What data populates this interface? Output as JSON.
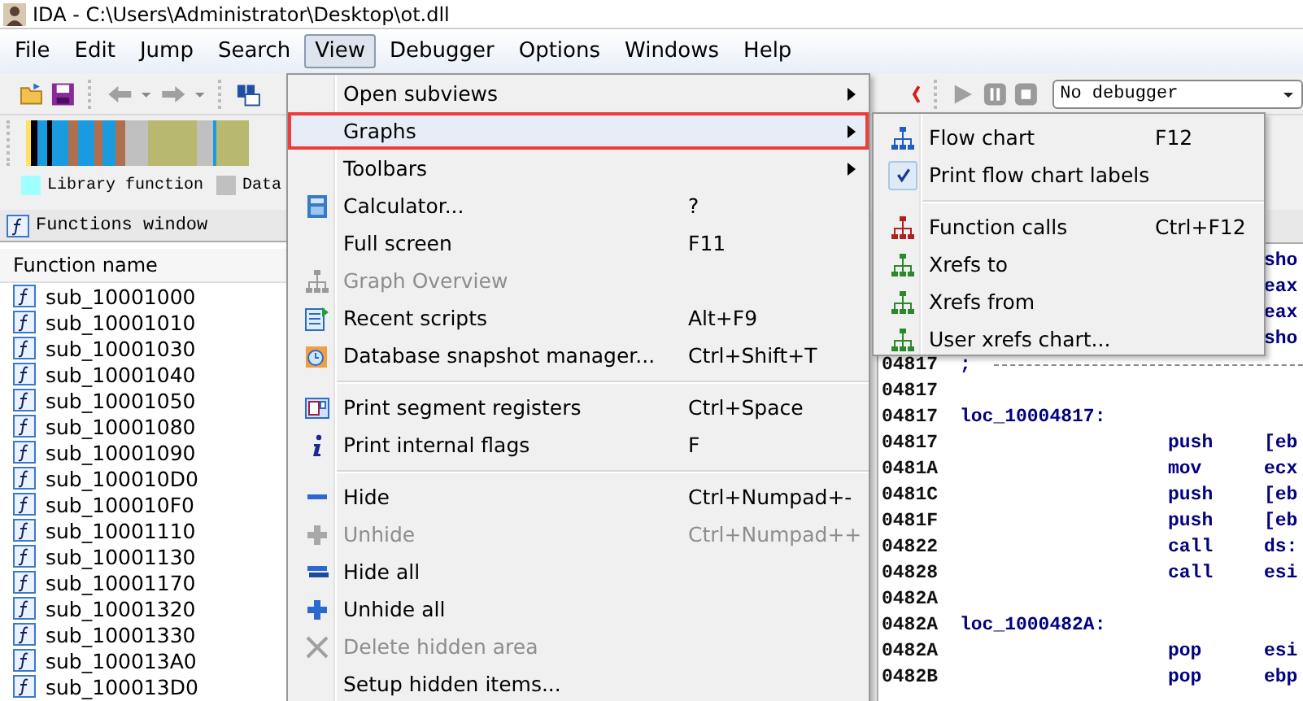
{
  "window": {
    "title": "IDA - C:\\Users\\Administrator\\Desktop\\ot.dll"
  },
  "menu_bar": [
    {
      "label": "File",
      "selected": false
    },
    {
      "label": "Edit",
      "selected": false
    },
    {
      "label": "Jump",
      "selected": false
    },
    {
      "label": "Search",
      "selected": false
    },
    {
      "label": "View",
      "selected": true
    },
    {
      "label": "Debugger",
      "selected": false
    },
    {
      "label": "Options",
      "selected": false
    },
    {
      "label": "Windows",
      "selected": false
    },
    {
      "label": "Help",
      "selected": false
    }
  ],
  "debugger_select": {
    "value": "No debugger"
  },
  "legend": [
    {
      "label": "Library function",
      "color": "#a0ffff"
    },
    {
      "label": "Data",
      "color": "#c0c0c0"
    }
  ],
  "functions_window": {
    "title": "Functions window",
    "column": "Function name",
    "rows": [
      "sub_10001000",
      "sub_10001010",
      "sub_10001030",
      "sub_10001040",
      "sub_10001050",
      "sub_10001080",
      "sub_10001090",
      "sub_100010D0",
      "sub_100010F0",
      "sub_10001110",
      "sub_10001130",
      "sub_10001170",
      "sub_10001320",
      "sub_10001330",
      "sub_100013A0",
      "sub_100013D0"
    ]
  },
  "disassembly": {
    "lines": [
      {
        "kind": "code",
        "operand": "sho"
      },
      {
        "kind": "code",
        "operand": "eax"
      },
      {
        "kind": "code",
        "operand": "eax"
      },
      {
        "kind": "code",
        "operand": "sho"
      },
      {
        "kind": "comment",
        "address": "04817",
        "text": ";"
      },
      {
        "kind": "code",
        "address": "04817"
      },
      {
        "kind": "code",
        "address": "04817",
        "label": "loc_10004817:"
      },
      {
        "kind": "code",
        "address": "04817",
        "mnemonic": "push",
        "operand": "[eb"
      },
      {
        "kind": "code",
        "address": "0481A",
        "mnemonic": "mov",
        "operand": "ecx"
      },
      {
        "kind": "code",
        "address": "0481C",
        "mnemonic": "push",
        "operand": "[eb"
      },
      {
        "kind": "code",
        "address": "0481F",
        "mnemonic": "push",
        "operand": "[eb"
      },
      {
        "kind": "code",
        "address": "04822",
        "mnemonic": "call",
        "operand": "ds:"
      },
      {
        "kind": "code",
        "address": "04828",
        "mnemonic": "call",
        "operand": "esi"
      },
      {
        "kind": "code",
        "address": "0482A"
      },
      {
        "kind": "code",
        "address": "0482A",
        "label": "loc_1000482A:"
      },
      {
        "kind": "code",
        "address": "0482A",
        "mnemonic": "pop",
        "operand": "esi"
      },
      {
        "kind": "code",
        "address": "0482B",
        "mnemonic": "pop",
        "operand": "ebp"
      }
    ]
  },
  "view_menu": {
    "items": [
      {
        "kind": "item",
        "label": "Open subviews",
        "submenu": true,
        "disabled": false,
        "selected": false
      },
      {
        "kind": "item",
        "label": "Graphs",
        "submenu": true,
        "disabled": false,
        "selected": true
      },
      {
        "kind": "item",
        "label": "Toolbars",
        "submenu": true,
        "disabled": false,
        "selected": false
      },
      {
        "kind": "item",
        "label": "Calculator...",
        "shortcut": "?",
        "submenu": false,
        "disabled": false,
        "selected": false
      },
      {
        "kind": "item",
        "label": "Full screen",
        "shortcut": "F11",
        "submenu": false,
        "disabled": false,
        "selected": false
      },
      {
        "kind": "item",
        "label": "Graph Overview",
        "submenu": false,
        "disabled": true,
        "selected": false
      },
      {
        "kind": "item",
        "label": "Recent scripts",
        "shortcut": "Alt+F9",
        "submenu": false,
        "disabled": false,
        "selected": false
      },
      {
        "kind": "item",
        "label": "Database snapshot manager...",
        "shortcut": "Ctrl+Shift+T",
        "submenu": false,
        "disabled": false,
        "selected": false
      },
      {
        "kind": "separator"
      },
      {
        "kind": "item",
        "label": "Print segment registers",
        "shortcut": "Ctrl+Space",
        "submenu": false,
        "disabled": false,
        "selected": false
      },
      {
        "kind": "item",
        "label": "Print internal flags",
        "shortcut": "F",
        "submenu": false,
        "disabled": false,
        "selected": false
      },
      {
        "kind": "separator"
      },
      {
        "kind": "item",
        "label": "Hide",
        "shortcut": "Ctrl+Numpad+-",
        "submenu": false,
        "disabled": false,
        "selected": false
      },
      {
        "kind": "item",
        "label": "Unhide",
        "shortcut": "Ctrl+Numpad++",
        "submenu": false,
        "disabled": true,
        "selected": false
      },
      {
        "kind": "item",
        "label": "Hide all",
        "submenu": false,
        "disabled": false,
        "selected": false
      },
      {
        "kind": "item",
        "label": "Unhide all",
        "submenu": false,
        "disabled": false,
        "selected": false
      },
      {
        "kind": "item",
        "label": "Delete hidden area",
        "submenu": false,
        "disabled": true,
        "selected": false
      },
      {
        "kind": "item",
        "label": "Setup hidden items...",
        "submenu": false,
        "disabled": false,
        "selected": false
      }
    ]
  },
  "graphs_submenu": {
    "items": [
      {
        "kind": "item",
        "label": "Flow chart",
        "shortcut": "F12",
        "checked": false
      },
      {
        "kind": "item",
        "label": "Print flow chart labels",
        "checked": true
      },
      {
        "kind": "separator"
      },
      {
        "kind": "item",
        "label": "Function calls",
        "shortcut": "Ctrl+F12",
        "checked": false
      },
      {
        "kind": "item",
        "label": "Xrefs to",
        "checked": false
      },
      {
        "kind": "item",
        "label": "Xrefs from",
        "checked": false
      },
      {
        "kind": "item",
        "label": "User xrefs chart...",
        "checked": false
      }
    ]
  }
}
